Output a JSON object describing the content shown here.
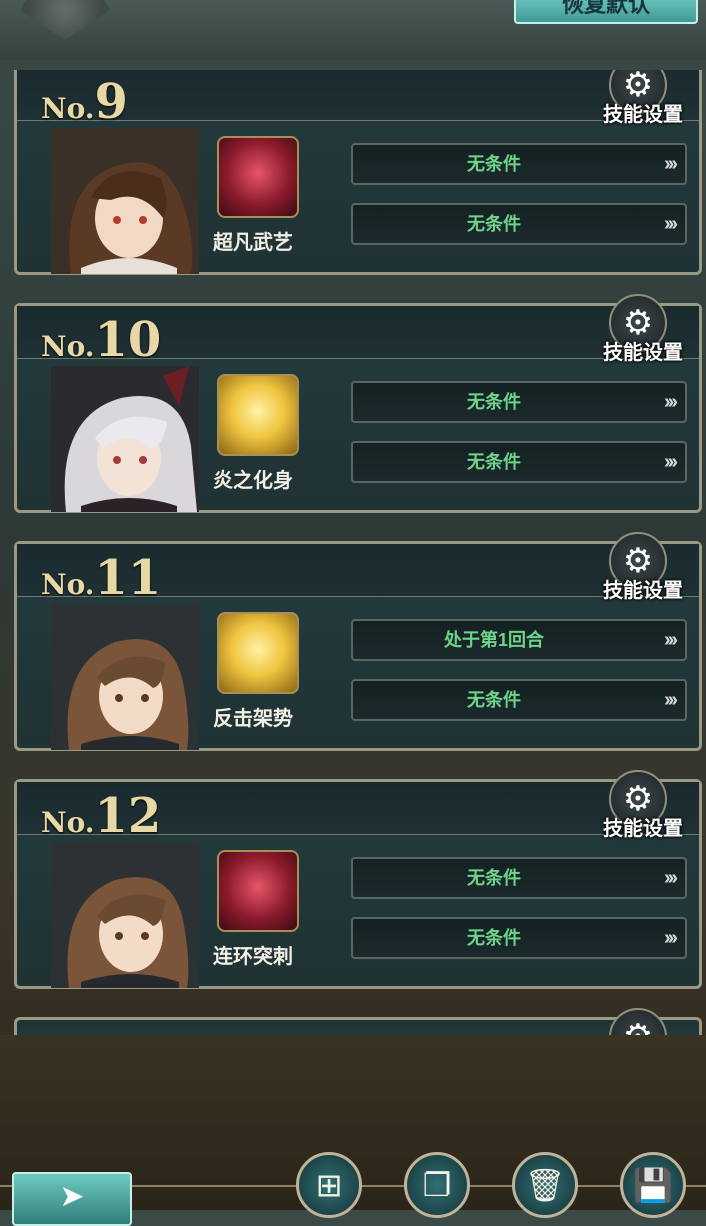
{
  "header": {
    "reset_button": "恢复默认"
  },
  "cards": [
    {
      "no_prefix": "No.",
      "no": "9",
      "gear_label": "技能设置",
      "skill": "超凡武艺",
      "conditions": [
        "无条件",
        "无条件"
      ]
    },
    {
      "no_prefix": "No.",
      "no": "10",
      "gear_label": "技能设置",
      "skill": "炎之化身",
      "conditions": [
        "无条件",
        "无条件"
      ]
    },
    {
      "no_prefix": "No.",
      "no": "11",
      "gear_label": "技能设置",
      "skill": "反击架势",
      "conditions": [
        "处于第1回合",
        "无条件"
      ]
    },
    {
      "no_prefix": "No.",
      "no": "12",
      "gear_label": "技能设置",
      "skill": "连环突刺",
      "conditions": [
        "无条件",
        "无条件"
      ]
    }
  ],
  "icons": {
    "gear": "gear-icon",
    "arrow": "triple-chevron-right-icon",
    "back": "back-arrow-icon",
    "add": "add-icon",
    "copy": "copy-icon",
    "delete": "trash-icon",
    "save": "save-icon"
  },
  "colors": {
    "condition_text": "#6ed48a",
    "accent": "#3f9a95",
    "frame": "#9a9a84"
  }
}
